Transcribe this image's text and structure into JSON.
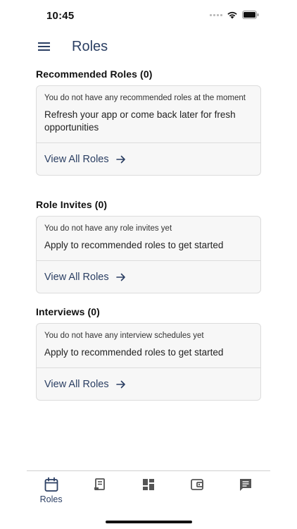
{
  "status_bar": {
    "time": "10:45"
  },
  "header": {
    "title": "Roles"
  },
  "sections": [
    {
      "title": "Recommended Roles (0)",
      "note": "You do not have any recommended roles at the moment",
      "main": "Refresh your app or come back later for fresh opportunities",
      "link": "View All Roles"
    },
    {
      "title": "Role Invites (0)",
      "note": "You do not have any role invites yet",
      "main": "Apply to recommended roles to get started",
      "link": "View All Roles"
    },
    {
      "title": "Interviews (0)",
      "note": "You do not have any interview schedules yet",
      "main": "Apply to recommended roles to get started",
      "link": "View All Roles"
    }
  ],
  "tab_bar": {
    "active_label": "Roles",
    "tabs": [
      {
        "icon": "calendar-icon",
        "label": "Roles",
        "active": true
      },
      {
        "icon": "receipt-icon",
        "active": false
      },
      {
        "icon": "dashboard-icon",
        "active": false
      },
      {
        "icon": "wallet-icon",
        "active": false
      },
      {
        "icon": "chat-icon",
        "active": false
      }
    ]
  },
  "colors": {
    "accent": "#2b3f63",
    "card_bg": "#f7f7f7",
    "border": "#dcdcdc",
    "inactive_icon": "#555555"
  }
}
